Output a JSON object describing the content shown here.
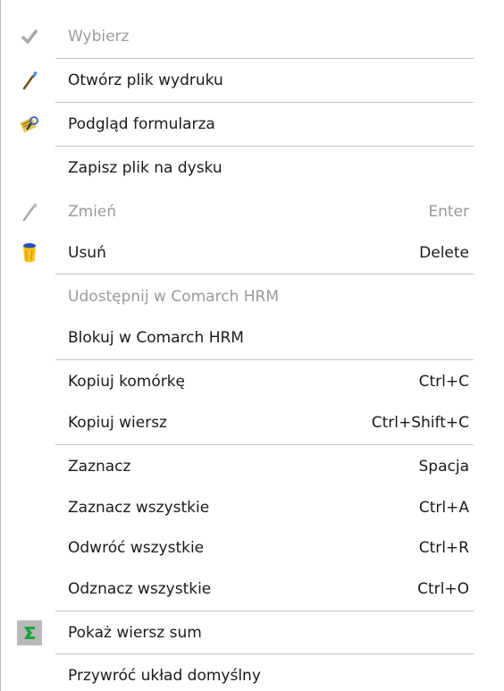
{
  "menu": {
    "items": [
      {
        "label": "Wybierz",
        "shortcut": "",
        "icon": "check-icon",
        "disabled": true
      },
      {
        "label": "Otwórz plik wydruku",
        "shortcut": "",
        "icon": "brush-icon",
        "disabled": false
      },
      {
        "label": "Podgląd formularza",
        "shortcut": "",
        "icon": "form-preview-icon",
        "disabled": false
      },
      {
        "label": "Zapisz plik na dysku",
        "shortcut": "",
        "icon": "",
        "disabled": false
      },
      {
        "label": "Zmień",
        "shortcut": "Enter",
        "icon": "brush-icon",
        "disabled": true
      },
      {
        "label": "Usuń",
        "shortcut": "Delete",
        "icon": "trash-bin-icon",
        "disabled": false
      },
      {
        "label": "Udostępnij w Comarch HRM",
        "shortcut": "",
        "icon": "",
        "disabled": true
      },
      {
        "label": "Blokuj w Comarch HRM",
        "shortcut": "",
        "icon": "",
        "disabled": false
      },
      {
        "label": "Kopiuj komórkę",
        "shortcut": "Ctrl+C",
        "icon": "",
        "disabled": false
      },
      {
        "label": "Kopiuj wiersz",
        "shortcut": "Ctrl+Shift+C",
        "icon": "",
        "disabled": false
      },
      {
        "label": "Zaznacz",
        "shortcut": "Spacja",
        "icon": "",
        "disabled": false
      },
      {
        "label": "Zaznacz wszystkie",
        "shortcut": "Ctrl+A",
        "icon": "",
        "disabled": false
      },
      {
        "label": "Odwróć wszystkie",
        "shortcut": "Ctrl+R",
        "icon": "",
        "disabled": false
      },
      {
        "label": "Odznacz wszystkie",
        "shortcut": "Ctrl+O",
        "icon": "",
        "disabled": false
      },
      {
        "label": "Pokaż wiersz sum",
        "shortcut": "",
        "icon": "sum-icon",
        "disabled": false,
        "checked": true
      },
      {
        "label": "Przywróć układ domyślny",
        "shortcut": "",
        "icon": "",
        "disabled": false
      }
    ]
  },
  "colors": {
    "disabled_text": "#9a9a9a",
    "text": "#1a1a1a",
    "separator": "#c4c4c4",
    "sum_icon_green": "#1aa33a",
    "trash_yellow": "#f3c11a",
    "trash_blue": "#2a4fb8"
  }
}
